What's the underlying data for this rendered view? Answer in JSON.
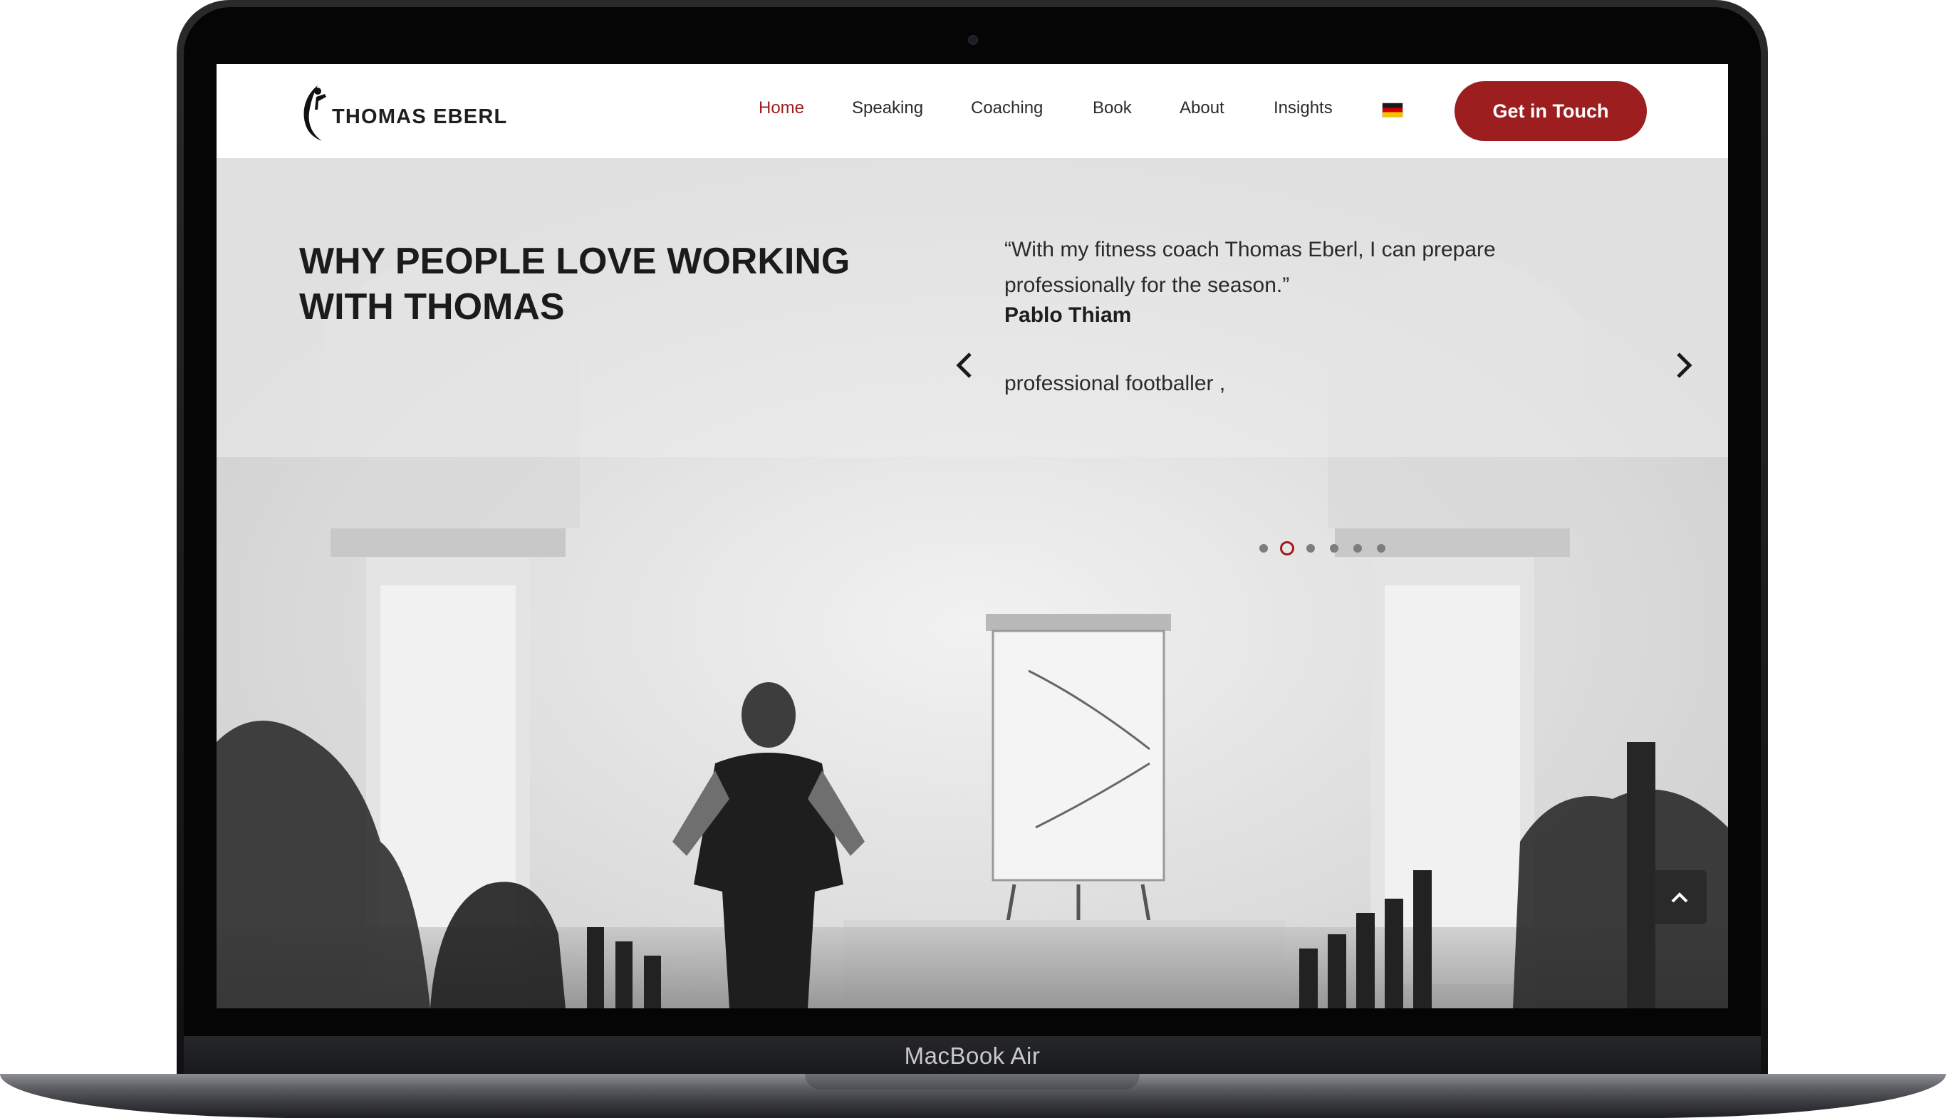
{
  "device": {
    "label": "MacBook Air"
  },
  "header": {
    "logo_text": "THOMAS EBERL",
    "nav": [
      {
        "label": "Home",
        "active": true
      },
      {
        "label": "Speaking",
        "active": false
      },
      {
        "label": "Coaching",
        "active": false
      },
      {
        "label": "Book",
        "active": false
      },
      {
        "label": "About",
        "active": false
      },
      {
        "label": "Insights",
        "active": false
      }
    ],
    "language_icon": "german-flag-icon",
    "cta_label": "Get in Touch"
  },
  "hero": {
    "title_line1": "WHY PEOPLE LOVE WORKING",
    "title_line2": "WITH THOMAS",
    "testimonial": {
      "quote": "“With my fitness coach Thomas Eberl, I can prepare professionally for the season.”",
      "author": "Pablo Thiam",
      "role": "professional footballer ,"
    },
    "carousel": {
      "slides": 6,
      "active_index": 1
    }
  },
  "colors": {
    "accent": "#9c1e1e",
    "text": "#1b1b1b",
    "header_bg": "#ffffff"
  },
  "icons": {
    "prev": "chevron-left-icon",
    "next": "chevron-right-icon",
    "scroll_top": "chevron-up-icon"
  }
}
